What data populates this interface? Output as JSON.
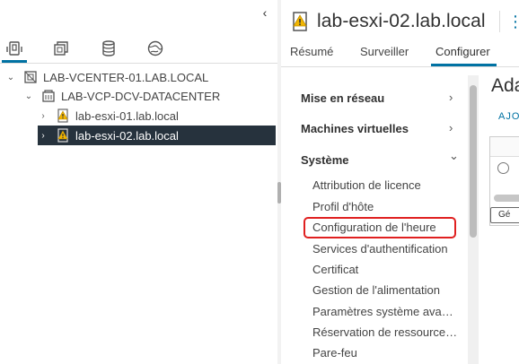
{
  "nav": {
    "collapse_glyph": "‹",
    "icon_tabs": [
      {
        "icon": "hosts-and-clusters-icon",
        "active": true
      },
      {
        "icon": "vms-and-templates-icon",
        "active": false
      },
      {
        "icon": "storage-icon",
        "active": false
      },
      {
        "icon": "networking-icon",
        "active": false
      }
    ],
    "tree": [
      {
        "label": "LAB-VCENTER-01.LAB.LOCAL",
        "expanded": true,
        "icon": "vcenter-icon"
      },
      {
        "label": "LAB-VCP-DCV-DATACENTER",
        "expanded": true,
        "icon": "datacenter-icon"
      },
      {
        "label": "lab-esxi-01.lab.local",
        "expanded": false,
        "icon": "host-warning-icon"
      },
      {
        "label": "lab-esxi-02.lab.local",
        "expanded": false,
        "icon": "host-warning-icon",
        "selected": true
      }
    ]
  },
  "header": {
    "title": "lab-esxi-02.lab.local",
    "more_glyph": "⋮"
  },
  "tabs": [
    {
      "label": "Résumé"
    },
    {
      "label": "Surveiller"
    },
    {
      "label": "Configurer",
      "active": true
    }
  ],
  "config_menu": {
    "sections": [
      {
        "label": "Mise en réseau",
        "chevron": "›"
      },
      {
        "label": "Machines virtuelles",
        "chevron": "›"
      },
      {
        "label": "Système",
        "chevron": "⌄"
      }
    ],
    "system_items": [
      "Attribution de licence",
      "Profil d'hôte",
      "Configuration de l'heure",
      "Services d'authentification",
      "Certificat",
      "Gestion de l'alimentation",
      "Paramètres système ava…",
      "Réservation de ressource…",
      "Pare-feu"
    ],
    "highlighted_item": "Configuration de l'heure"
  },
  "content": {
    "title": "Ada",
    "link": "AJO",
    "button": "Gé"
  },
  "colors": {
    "accent": "#0072a3",
    "selected_bg": "#26323d",
    "highlight_border": "#e02020",
    "warning": "#f2b600"
  }
}
